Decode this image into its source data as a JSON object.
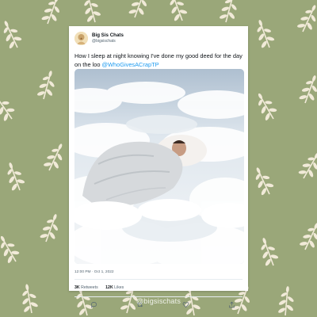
{
  "colors": {
    "background": "#9aa779",
    "leaf": "#f1ead8",
    "mention": "#1d9bf0",
    "text": "#0f1419",
    "muted": "#536471"
  },
  "tweet": {
    "author_name": "Big Sis Chats",
    "author_handle": "@bigsischats",
    "text": "How I sleep at night knowing I've done my good deed for the day on the loo ",
    "mention": "@WhoGivesACrapTP",
    "timestamp": "12:00 PM · Oct 1, 2022",
    "retweets_count": "3K",
    "retweets_label": "Retweets",
    "likes_count": "12K",
    "likes_label": "Likes",
    "media_description": ""
  },
  "actions": [
    {
      "icon": "reply-icon"
    },
    {
      "icon": "retweet-icon"
    },
    {
      "icon": "like-icon"
    },
    {
      "icon": "share-icon"
    }
  ],
  "watermark": "@bigsischats"
}
